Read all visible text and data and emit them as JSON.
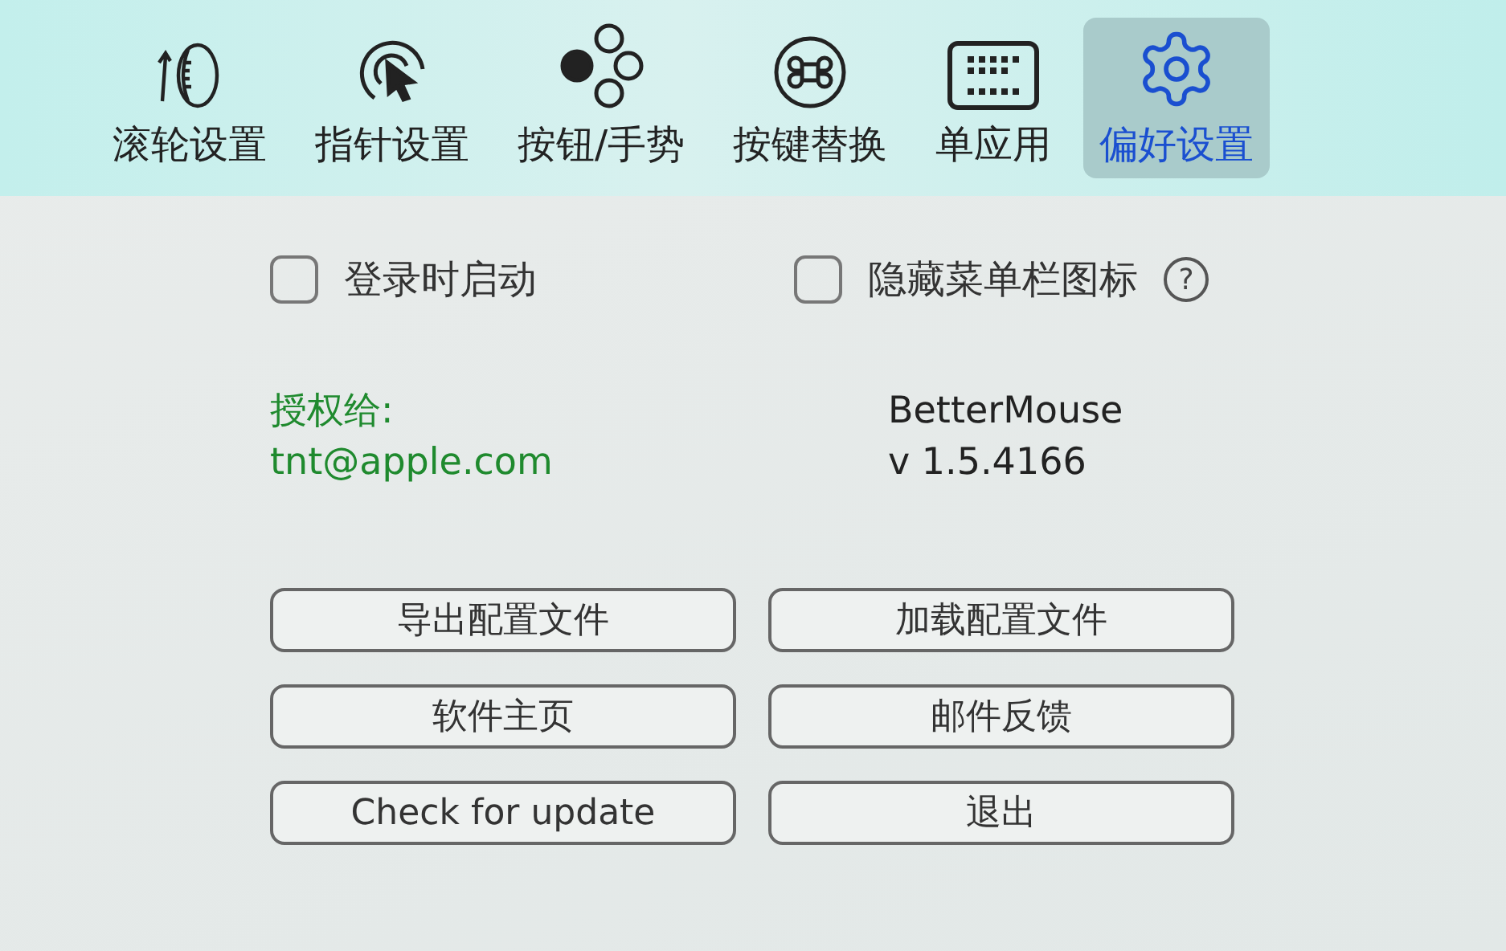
{
  "toolbar": {
    "tabs": [
      {
        "label": "滚轮设置",
        "selected": false
      },
      {
        "label": "指针设置",
        "selected": false
      },
      {
        "label": "按钮/手势",
        "selected": false
      },
      {
        "label": "按键替换",
        "selected": false
      },
      {
        "label": "单应用",
        "selected": false
      },
      {
        "label": "偏好设置",
        "selected": true
      }
    ]
  },
  "options": [
    {
      "label": "登录时启动",
      "checked": false
    },
    {
      "label": "隐藏菜单栏图标",
      "checked": false,
      "help_text": "?"
    }
  ],
  "license": {
    "heading": "授权给:",
    "email": "tnt@apple.com"
  },
  "app": {
    "name": "BetterMouse",
    "version": "v 1.5.4166"
  },
  "buttons": [
    "导出配置文件",
    "加载配置文件",
    "软件主页",
    "邮件反馈",
    "Check for update",
    "退出"
  ]
}
